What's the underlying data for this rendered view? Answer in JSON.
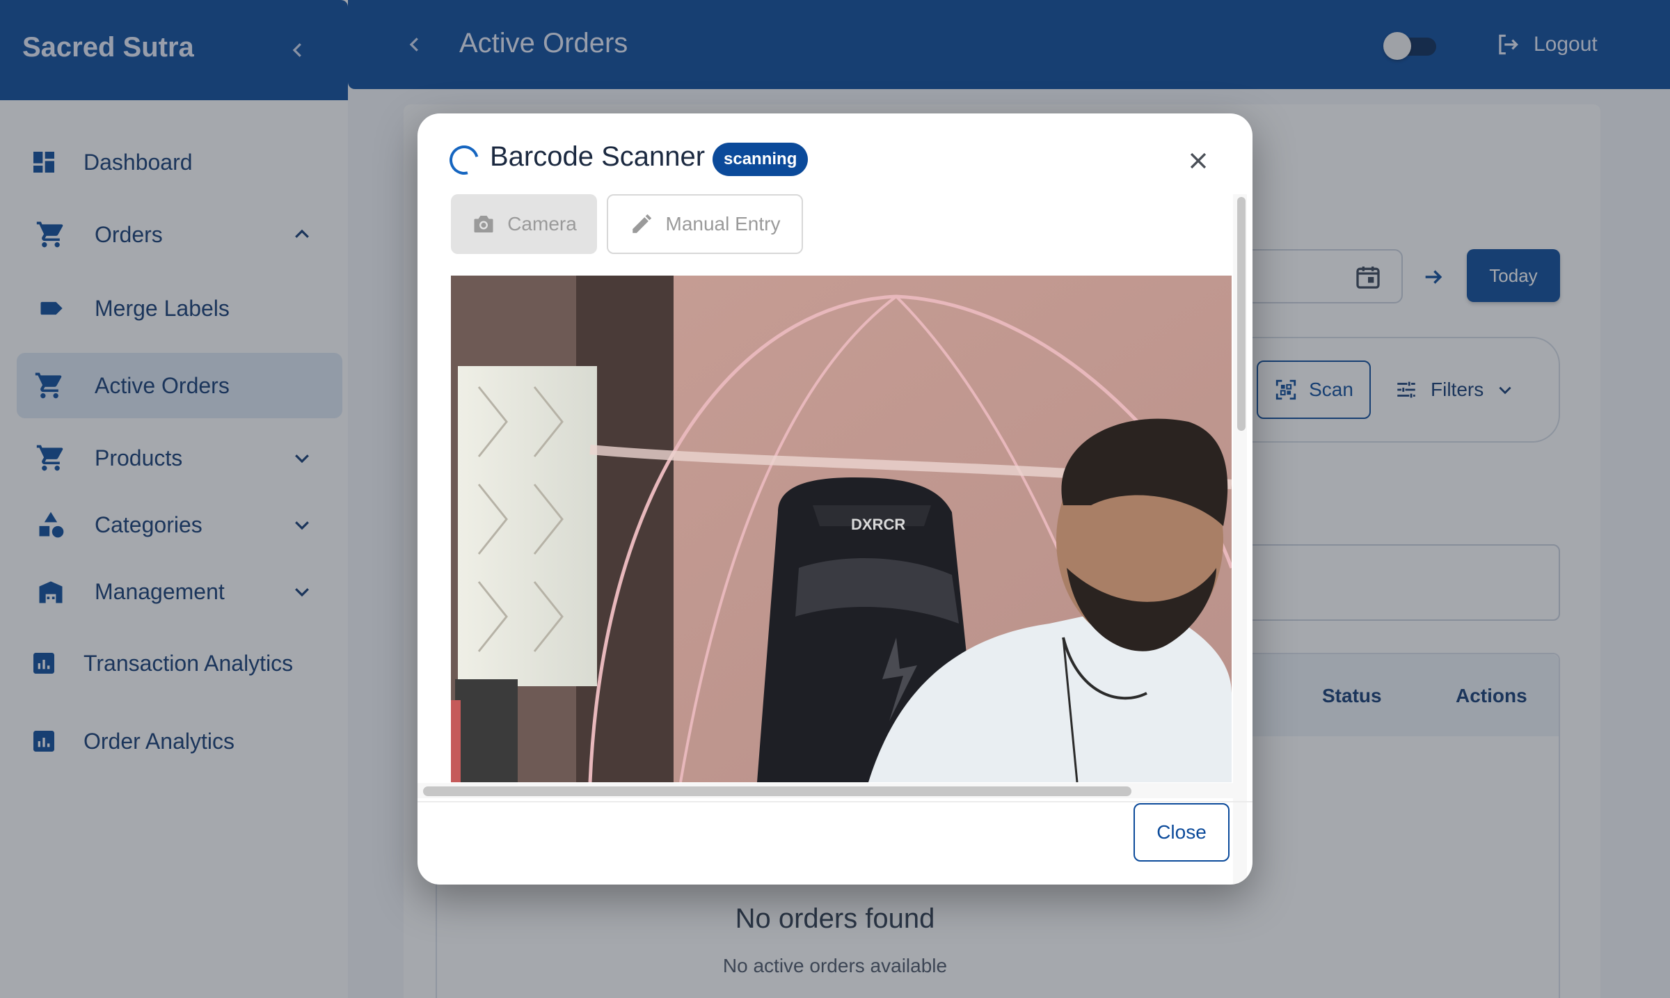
{
  "app": {
    "brand": "Sacred Sutra"
  },
  "sidebar": {
    "items": [
      {
        "label": "Dashboard",
        "icon": "dashboard-icon"
      },
      {
        "label": "Orders",
        "icon": "cart-icon",
        "expanded": true
      },
      {
        "label": "Merge Labels",
        "icon": "label-icon"
      },
      {
        "label": "Active Orders",
        "icon": "cart-icon",
        "active": true
      },
      {
        "label": "Products",
        "icon": "cart-icon",
        "expanded": false
      },
      {
        "label": "Categories",
        "icon": "category-shapes-icon",
        "expanded": false
      },
      {
        "label": "Management",
        "icon": "warehouse-icon",
        "expanded": false
      },
      {
        "label": "Transaction Analytics",
        "icon": "analytics-icon"
      },
      {
        "label": "Order Analytics",
        "icon": "analytics-icon"
      }
    ]
  },
  "topbar": {
    "title": "Active Orders",
    "logout_label": "Logout",
    "theme_toggle_on": false
  },
  "page": {
    "today_label": "Today",
    "scan_label": "Scan",
    "filters_label": "Filters",
    "table_headers": [
      "Status",
      "Actions"
    ],
    "empty_title": "No orders found",
    "empty_subtitle": "No active orders available"
  },
  "modal": {
    "title": "Barcode Scanner",
    "badge": "scanning",
    "tabs": [
      {
        "label": "Camera",
        "icon": "camera-icon",
        "selected": true
      },
      {
        "label": "Manual Entry",
        "icon": "pencil-icon",
        "selected": false
      }
    ],
    "close_label": "Close"
  },
  "colors": {
    "primary": "#0b4a9a",
    "sidebar_active": "#dfe8f5",
    "nav_text": "#123a72"
  }
}
